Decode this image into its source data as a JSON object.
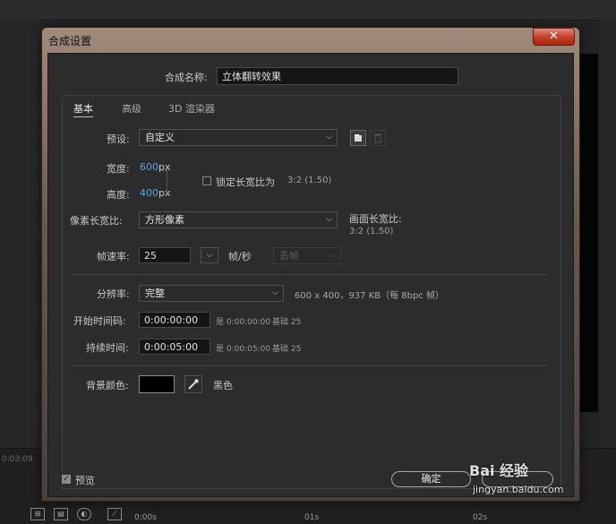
{
  "window": {
    "title": "合成设置",
    "close_label": "✕"
  },
  "comp_name": {
    "label": "合成名称:",
    "value": "立体翻转效果"
  },
  "tabs": [
    {
      "label": "基本"
    },
    {
      "label": "高级"
    },
    {
      "label": "3D 渲染器"
    }
  ],
  "preset": {
    "label": "预设:",
    "value": "自定义"
  },
  "width": {
    "label": "宽度:",
    "value": "600",
    "unit": "px"
  },
  "height": {
    "label": "高度:",
    "value": "400",
    "unit": "px"
  },
  "lock_aspect": {
    "label": "锁定长宽比为",
    "ratio": "3:2 (1.50)",
    "checked": false
  },
  "pixel_aspect": {
    "label": "像素长宽比:",
    "value": "方形像素"
  },
  "frame_aspect": {
    "label": "画面长宽比:",
    "value": "3:2 (1.50)"
  },
  "frame_rate": {
    "label": "帧速率:",
    "value": "25",
    "unit": "帧/秒",
    "drop_frame": "丢帧"
  },
  "resolution": {
    "label": "分辨率:",
    "value": "完整",
    "info": "600 x 400，937 KB（每 8bpc 帧）"
  },
  "start_timecode": {
    "label": "开始时间码:",
    "value": "0:00:00:00",
    "info": "是 0:00:00:00",
    "base": "基础 25"
  },
  "duration": {
    "label": "持续时间:",
    "value": "0:00:05:00",
    "info": "是 0:00:05:00",
    "base": "基础 25"
  },
  "background": {
    "label": "背景颜色:",
    "color": "#000000",
    "color_name": "黑色"
  },
  "preview": {
    "label": "预览",
    "checked": true
  },
  "buttons": {
    "ok": "确定"
  },
  "timeline": {
    "timecode": "0:03:09",
    "ticks": [
      "0:00s",
      "01s",
      "02s"
    ]
  },
  "watermark": {
    "brand": "Bai 经验",
    "url": "jingyan.baidu.com"
  }
}
